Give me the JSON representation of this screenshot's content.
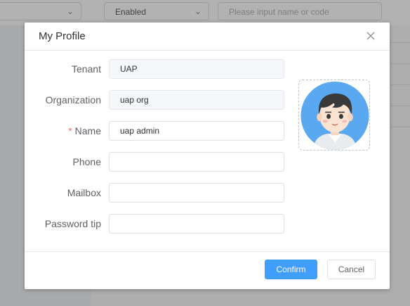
{
  "background": {
    "status_select": "Enabled",
    "search_placeholder": "Please input name or code"
  },
  "dialog": {
    "title": "My Profile",
    "fields": [
      {
        "label": "Tenant",
        "value": "UAP",
        "disabled": true,
        "required": false
      },
      {
        "label": "Organization",
        "value": "uap org",
        "disabled": true,
        "required": false
      },
      {
        "label": "Name",
        "value": "uap admin",
        "disabled": false,
        "required": true
      },
      {
        "label": "Phone",
        "value": "",
        "disabled": false,
        "required": false
      },
      {
        "label": "Mailbox",
        "value": "",
        "disabled": false,
        "required": false
      },
      {
        "label": "Password tip",
        "value": "",
        "disabled": false,
        "required": false
      }
    ],
    "required_mark": "*",
    "confirm_label": "Confirm",
    "cancel_label": "Cancel"
  },
  "colors": {
    "primary": "#409eff",
    "required": "#f56c6c",
    "avatar_bg": "#5aa9f0"
  },
  "icons": {
    "close": "close-icon",
    "chevron": "chevron-down-icon",
    "avatar": "user-avatar-icon"
  }
}
